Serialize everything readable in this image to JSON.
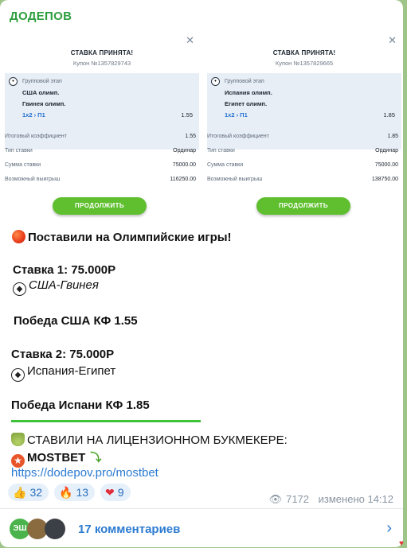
{
  "channel": {
    "name": "ДОДЕПОВ"
  },
  "coupons": [
    {
      "title": "СТАВКА ПРИНЯТА!",
      "coupon": "Купон №1357829743",
      "stage": "Групповой этап",
      "team1": "США олимп.",
      "team2": "Гвинея олимп.",
      "market": "1x2 › П1",
      "odd": "1.55",
      "rows": [
        {
          "label": "Итоговый коэффициент",
          "value": "1.55"
        },
        {
          "label": "Тип ставки",
          "value": "Ординар"
        },
        {
          "label": "Сумма ставки",
          "value": "75000.00"
        },
        {
          "label": "Возможный выигрыш",
          "value": "116250.00"
        }
      ],
      "button": "ПРОДОЛЖИТЬ"
    },
    {
      "title": "СТАВКА ПРИНЯТА!",
      "coupon": "Купон №1357829665",
      "stage": "Групповой этап",
      "team1": "Испания олимп.",
      "team2": "Египет олимп.",
      "market": "1x2 › П1",
      "odd": "1.85",
      "rows": [
        {
          "label": "Итоговый коэффициент",
          "value": "1.85"
        },
        {
          "label": "Тип ставки",
          "value": "Ординар"
        },
        {
          "label": "Сумма ставки",
          "value": "75000.00"
        },
        {
          "label": "Возможный выигрыш",
          "value": "138750.00"
        }
      ],
      "button": "ПРОДОЛЖИТЬ"
    }
  ],
  "message": {
    "headline": "Поставили на Олимпийские игры!",
    "bet1_title": "Ставка 1: 75.000Р",
    "bet1_match": "США-Гвинея",
    "bet1_pick": "Победа США КФ 1.55",
    "bet2_title": "Ставка 2: 75.000Р",
    "bet2_match": "Испания-Египет",
    "bet2_pick": "Победа Испани КФ 1.85",
    "bookmaker_line": "СТАВИЛИ НА ЛИЦЕНЗИОННОМ БУКМЕКЕРЕ:",
    "bookmaker": "MOSTBET",
    "link": "https://dodepov.pro/mostbet"
  },
  "reactions": [
    {
      "icon": "thumbs-up-icon",
      "glyph": "👍",
      "count": "32"
    },
    {
      "icon": "fire-icon",
      "glyph": "🔥",
      "count": "13"
    },
    {
      "icon": "heart-icon",
      "glyph": "❤",
      "count": "9"
    }
  ],
  "meta": {
    "views": "7172",
    "edited": "изменено 14:12"
  },
  "comments": {
    "avatar1_initials": "ЭШ",
    "label": "17 комментариев"
  },
  "colors": {
    "channel": "#2e9e3f",
    "button": "#5fbf2e",
    "link": "#2c7bd1",
    "divider": "#3ec23a"
  }
}
